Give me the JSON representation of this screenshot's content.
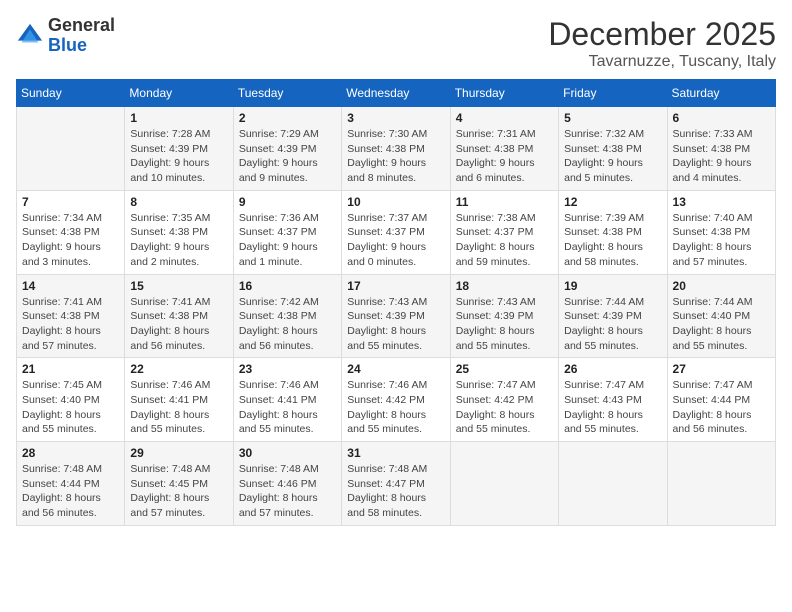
{
  "logo": {
    "general": "General",
    "blue": "Blue"
  },
  "title": "December 2025",
  "location": "Tavarnuzze, Tuscany, Italy",
  "days_of_week": [
    "Sunday",
    "Monday",
    "Tuesday",
    "Wednesday",
    "Thursday",
    "Friday",
    "Saturday"
  ],
  "weeks": [
    [
      {
        "day": "",
        "sunrise": "",
        "sunset": "",
        "daylight": ""
      },
      {
        "day": "1",
        "sunrise": "Sunrise: 7:28 AM",
        "sunset": "Sunset: 4:39 PM",
        "daylight": "Daylight: 9 hours and 10 minutes."
      },
      {
        "day": "2",
        "sunrise": "Sunrise: 7:29 AM",
        "sunset": "Sunset: 4:39 PM",
        "daylight": "Daylight: 9 hours and 9 minutes."
      },
      {
        "day": "3",
        "sunrise": "Sunrise: 7:30 AM",
        "sunset": "Sunset: 4:38 PM",
        "daylight": "Daylight: 9 hours and 8 minutes."
      },
      {
        "day": "4",
        "sunrise": "Sunrise: 7:31 AM",
        "sunset": "Sunset: 4:38 PM",
        "daylight": "Daylight: 9 hours and 6 minutes."
      },
      {
        "day": "5",
        "sunrise": "Sunrise: 7:32 AM",
        "sunset": "Sunset: 4:38 PM",
        "daylight": "Daylight: 9 hours and 5 minutes."
      },
      {
        "day": "6",
        "sunrise": "Sunrise: 7:33 AM",
        "sunset": "Sunset: 4:38 PM",
        "daylight": "Daylight: 9 hours and 4 minutes."
      }
    ],
    [
      {
        "day": "7",
        "sunrise": "Sunrise: 7:34 AM",
        "sunset": "Sunset: 4:38 PM",
        "daylight": "Daylight: 9 hours and 3 minutes."
      },
      {
        "day": "8",
        "sunrise": "Sunrise: 7:35 AM",
        "sunset": "Sunset: 4:38 PM",
        "daylight": "Daylight: 9 hours and 2 minutes."
      },
      {
        "day": "9",
        "sunrise": "Sunrise: 7:36 AM",
        "sunset": "Sunset: 4:37 PM",
        "daylight": "Daylight: 9 hours and 1 minute."
      },
      {
        "day": "10",
        "sunrise": "Sunrise: 7:37 AM",
        "sunset": "Sunset: 4:37 PM",
        "daylight": "Daylight: 9 hours and 0 minutes."
      },
      {
        "day": "11",
        "sunrise": "Sunrise: 7:38 AM",
        "sunset": "Sunset: 4:37 PM",
        "daylight": "Daylight: 8 hours and 59 minutes."
      },
      {
        "day": "12",
        "sunrise": "Sunrise: 7:39 AM",
        "sunset": "Sunset: 4:38 PM",
        "daylight": "Daylight: 8 hours and 58 minutes."
      },
      {
        "day": "13",
        "sunrise": "Sunrise: 7:40 AM",
        "sunset": "Sunset: 4:38 PM",
        "daylight": "Daylight: 8 hours and 57 minutes."
      }
    ],
    [
      {
        "day": "14",
        "sunrise": "Sunrise: 7:41 AM",
        "sunset": "Sunset: 4:38 PM",
        "daylight": "Daylight: 8 hours and 57 minutes."
      },
      {
        "day": "15",
        "sunrise": "Sunrise: 7:41 AM",
        "sunset": "Sunset: 4:38 PM",
        "daylight": "Daylight: 8 hours and 56 minutes."
      },
      {
        "day": "16",
        "sunrise": "Sunrise: 7:42 AM",
        "sunset": "Sunset: 4:38 PM",
        "daylight": "Daylight: 8 hours and 56 minutes."
      },
      {
        "day": "17",
        "sunrise": "Sunrise: 7:43 AM",
        "sunset": "Sunset: 4:39 PM",
        "daylight": "Daylight: 8 hours and 55 minutes."
      },
      {
        "day": "18",
        "sunrise": "Sunrise: 7:43 AM",
        "sunset": "Sunset: 4:39 PM",
        "daylight": "Daylight: 8 hours and 55 minutes."
      },
      {
        "day": "19",
        "sunrise": "Sunrise: 7:44 AM",
        "sunset": "Sunset: 4:39 PM",
        "daylight": "Daylight: 8 hours and 55 minutes."
      },
      {
        "day": "20",
        "sunrise": "Sunrise: 7:44 AM",
        "sunset": "Sunset: 4:40 PM",
        "daylight": "Daylight: 8 hours and 55 minutes."
      }
    ],
    [
      {
        "day": "21",
        "sunrise": "Sunrise: 7:45 AM",
        "sunset": "Sunset: 4:40 PM",
        "daylight": "Daylight: 8 hours and 55 minutes."
      },
      {
        "day": "22",
        "sunrise": "Sunrise: 7:46 AM",
        "sunset": "Sunset: 4:41 PM",
        "daylight": "Daylight: 8 hours and 55 minutes."
      },
      {
        "day": "23",
        "sunrise": "Sunrise: 7:46 AM",
        "sunset": "Sunset: 4:41 PM",
        "daylight": "Daylight: 8 hours and 55 minutes."
      },
      {
        "day": "24",
        "sunrise": "Sunrise: 7:46 AM",
        "sunset": "Sunset: 4:42 PM",
        "daylight": "Daylight: 8 hours and 55 minutes."
      },
      {
        "day": "25",
        "sunrise": "Sunrise: 7:47 AM",
        "sunset": "Sunset: 4:42 PM",
        "daylight": "Daylight: 8 hours and 55 minutes."
      },
      {
        "day": "26",
        "sunrise": "Sunrise: 7:47 AM",
        "sunset": "Sunset: 4:43 PM",
        "daylight": "Daylight: 8 hours and 55 minutes."
      },
      {
        "day": "27",
        "sunrise": "Sunrise: 7:47 AM",
        "sunset": "Sunset: 4:44 PM",
        "daylight": "Daylight: 8 hours and 56 minutes."
      }
    ],
    [
      {
        "day": "28",
        "sunrise": "Sunrise: 7:48 AM",
        "sunset": "Sunset: 4:44 PM",
        "daylight": "Daylight: 8 hours and 56 minutes."
      },
      {
        "day": "29",
        "sunrise": "Sunrise: 7:48 AM",
        "sunset": "Sunset: 4:45 PM",
        "daylight": "Daylight: 8 hours and 57 minutes."
      },
      {
        "day": "30",
        "sunrise": "Sunrise: 7:48 AM",
        "sunset": "Sunset: 4:46 PM",
        "daylight": "Daylight: 8 hours and 57 minutes."
      },
      {
        "day": "31",
        "sunrise": "Sunrise: 7:48 AM",
        "sunset": "Sunset: 4:47 PM",
        "daylight": "Daylight: 8 hours and 58 minutes."
      },
      {
        "day": "",
        "sunrise": "",
        "sunset": "",
        "daylight": ""
      },
      {
        "day": "",
        "sunrise": "",
        "sunset": "",
        "daylight": ""
      },
      {
        "day": "",
        "sunrise": "",
        "sunset": "",
        "daylight": ""
      }
    ]
  ]
}
